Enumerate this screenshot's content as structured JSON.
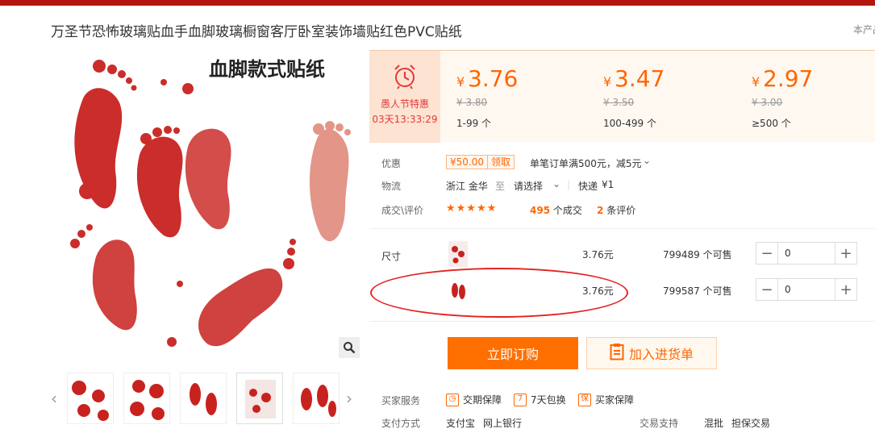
{
  "header": {
    "title": "万圣节恐怖玻璃贴血手血脚玻璃橱窗客厅卧室装饰墙贴红色PVC贴纸",
    "right_note": "本产品"
  },
  "gallery": {
    "main_image_caption": "血脚款式贴纸",
    "zoom_icon": "magnifier-icon",
    "prev_icon": "chevron-left-icon",
    "next_icon": "chevron-right-icon"
  },
  "promo": {
    "icon": "alarm-clock-icon",
    "label": "愚人节特惠",
    "countdown": "03天13:33:29"
  },
  "price_tiers": [
    {
      "currency": "¥",
      "price": "3.76",
      "original": "¥ 3.80",
      "range": "1-99 个"
    },
    {
      "currency": "¥",
      "price": "3.47",
      "original": "¥ 3.50",
      "range": "100-499 个"
    },
    {
      "currency": "¥",
      "price": "2.97",
      "original": "¥ 3.00",
      "range": "≥500 个"
    }
  ],
  "discount": {
    "label": "优惠",
    "coupon_amount": "¥50.00",
    "coupon_action": "领取",
    "description": "单笔订单满500元，减5元",
    "chevron_icon": "chevron-down-icon"
  },
  "logistics": {
    "label": "物流",
    "origin": "浙江 金华",
    "to": "至",
    "destination": "请选择",
    "method": "快递",
    "fee": "¥1"
  },
  "sales": {
    "label": "成交\\评价",
    "stars": "★★★★★",
    "rating": 5,
    "deals_count": "495",
    "deals_suffix": "个成交",
    "reviews_count": "2",
    "reviews_suffix": "条评价"
  },
  "sku": {
    "label": "尺寸",
    "rows": [
      {
        "price": "3.76元",
        "stock": "799489 个可售",
        "qty": "0"
      },
      {
        "price": "3.76元",
        "stock": "799587 个可售",
        "qty": "0"
      }
    ],
    "minus": "−",
    "plus": "+"
  },
  "actions": {
    "order": "立即订购",
    "cart": "加入进货单",
    "cart_icon": "clipboard-icon"
  },
  "services": {
    "label": "买家服务",
    "items": [
      "交期保障",
      "7天包换",
      "买家保障"
    ]
  },
  "payment": {
    "label": "支付方式",
    "methods": [
      "支付宝",
      "网上银行"
    ],
    "trade_label": "交易支持",
    "trade_items": [
      "混批",
      "担保交易"
    ]
  },
  "colors": {
    "brand_red": "#b3150f",
    "accent_orange": "#ff6600",
    "button_orange": "#ff6f00",
    "annotation_red": "#e52321"
  }
}
